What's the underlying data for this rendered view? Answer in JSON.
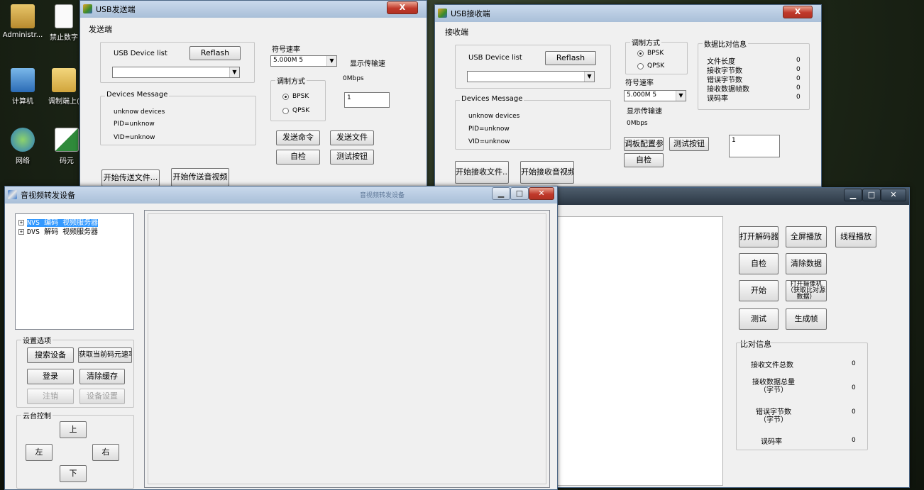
{
  "desktop": {
    "icons": [
      {
        "label": "Administr...",
        "icon": "user-folder-icon"
      },
      {
        "label": "禁止数字",
        "icon": "document-icon"
      },
      {
        "label": "计算机",
        "icon": "computer-icon"
      },
      {
        "label": "调制端上(",
        "icon": "folder-icon"
      },
      {
        "label": "网络",
        "icon": "network-icon"
      },
      {
        "label": "码元",
        "icon": "excel-icon"
      }
    ]
  },
  "usb_send": {
    "title": "USB发送端",
    "close": "X",
    "section": "发送端",
    "device_list_label": "USB Device list",
    "reflash": "Reflash",
    "device_select": "",
    "devices_message_label": "Devices Message",
    "devices": [
      "unknow devices",
      "PID=unknow",
      "VID=unknow"
    ],
    "symbol_rate_label": "符号速率",
    "symbol_rate_value": "5.000M 5",
    "show_rate_label": "显示传输速",
    "rate_value": "0Mbps",
    "modulation_label": "调制方式",
    "bpsk": "BPSK",
    "qpsk": "QPSK",
    "input_value": "1",
    "send_cmd": "发送命令",
    "send_file": "发送文件",
    "self_check": "自检",
    "test_button": "测试按钮",
    "start_file": "开始传送文件...",
    "start_av": "开始传送音视频"
  },
  "usb_recv": {
    "title": "USB接收端",
    "close": "X",
    "section": "接收端",
    "device_list_label": "USB Device list",
    "reflash": "Reflash",
    "device_select": "",
    "devices_message_label": "Devices Message",
    "devices": [
      "unknow devices",
      "PID=unknow",
      "VID=unknow"
    ],
    "modulation_label": "调制方式",
    "bpsk": "BPSK",
    "qpsk": "QPSK",
    "symbol_rate_label": "符号速率",
    "symbol_rate_value": "5.000M 5",
    "show_rate_label": "显示传输速",
    "rate_value": "0Mbps",
    "compare_label": "数据比对信息",
    "compare_rows": [
      {
        "label": "文件长度",
        "value": "0"
      },
      {
        "label": "接收字节数",
        "value": "0"
      },
      {
        "label": "错误字节数",
        "value": "0"
      },
      {
        "label": "接收数据帧数",
        "value": "0"
      },
      {
        "label": "误码率",
        "value": "0"
      }
    ],
    "config_btn": "调板配置参",
    "test_button": "测试按钮",
    "self_check": "自检",
    "input_value": "1",
    "start_file": "开始接收文件...",
    "start_av": "开始接收音视频"
  },
  "av_forward": {
    "title": "音视频转发设备",
    "tree": [
      {
        "label": "NVS 编码 视频服务器",
        "selected": true
      },
      {
        "label": "DVS 解码 视频服务器",
        "selected": false
      }
    ],
    "settings_label": "设置选项",
    "search_device": "搜索设备",
    "get_rate": "获取当前码元速率",
    "login": "登录",
    "clear_cache": "清除缓存",
    "logout": "注销",
    "device_settings": "设备设置",
    "ptz_label": "云台控制",
    "up": "上",
    "left": "左",
    "right": "右",
    "down": "下",
    "taskbar_ghost": "音视频转发设备"
  },
  "decoder": {
    "open_decoder": "打开解码器",
    "fullscreen": "全屏播放",
    "thread_play": "线程播放",
    "self_check": "自检",
    "clear_data": "清除数据",
    "start": "开始",
    "open_camera": "打开摄像机（获取比对源数据）",
    "test": "测试",
    "gen_frame": "生成帧",
    "compare_label": "比对信息",
    "compare_rows": [
      {
        "label": "接收文件总数",
        "value": "0"
      },
      {
        "label": "接收数据总量（字节）",
        "value": "0"
      },
      {
        "label": "错误字节数（字节）",
        "value": "0"
      },
      {
        "label": "误码率",
        "value": "0"
      }
    ]
  }
}
